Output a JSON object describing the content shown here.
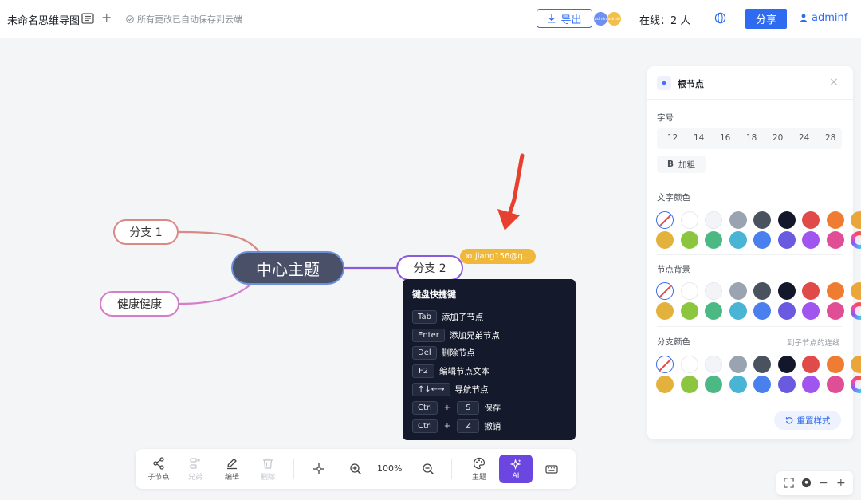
{
  "header": {
    "doc_title": "未命名思维导图",
    "save_status": "所有更改已自动保存到云端",
    "export_label": "导出",
    "avatars": [
      "admin",
      "admin"
    ],
    "online_text": "在线：2 人",
    "share_label": "分享",
    "user_name": "adminf"
  },
  "canvas": {
    "center_node": "中心主题",
    "branch1": "分支 1",
    "branch2": "健康健康",
    "branch3": "分支 2",
    "collaborator_tag": "xujiang156@q..."
  },
  "shortcuts": {
    "title": "键盘快捷键",
    "items": [
      {
        "keys": [
          "Tab"
        ],
        "desc": "添加子节点"
      },
      {
        "keys": [
          "Enter"
        ],
        "desc": "添加兄弟节点"
      },
      {
        "keys": [
          "Del"
        ],
        "desc": "删除节点"
      },
      {
        "keys": [
          "F2"
        ],
        "desc": "编辑节点文本"
      },
      {
        "keys": [
          "↑↓←→"
        ],
        "desc": "导航节点"
      },
      {
        "keys": [
          "Ctrl",
          "S"
        ],
        "desc": "保存"
      },
      {
        "keys": [
          "Ctrl",
          "Z"
        ],
        "desc": "撤销"
      }
    ]
  },
  "toolbar": {
    "child_label": "子节点",
    "sibling_label": "兄弟",
    "edit_label": "编辑",
    "delete_label": "删除",
    "zoom": "100%",
    "theme_label": "主题",
    "ai_label": "AI"
  },
  "panel": {
    "title": "根节点",
    "font_size_label": "字号",
    "font_sizes": [
      "12",
      "14",
      "16",
      "18",
      "20",
      "24",
      "28"
    ],
    "bold_label": "加粗",
    "bold_glyph": "B",
    "text_color_label": "文字颜色",
    "node_bg_label": "节点背景",
    "branch_color_label": "分支颜色",
    "branch_color_hint": "到子节点的连线",
    "reset_label": "重置样式",
    "swatches": [
      "none",
      "#ffffff",
      "#f2f4f7",
      "#9aa3b0",
      "#4a5260",
      "#121829",
      "#e04a48",
      "#ee7d32",
      "#eba63a",
      "#e2b23c",
      "#8cc63f",
      "#4cb984",
      "#4ab4d4",
      "#4a80ee",
      "#6a5ae0",
      "#a055ee",
      "#e04e96",
      "rainbow"
    ]
  },
  "colors": {
    "accent": "#2f6bf0",
    "ai_purple": "#6b46e0",
    "center_fill": "#4a5068"
  }
}
